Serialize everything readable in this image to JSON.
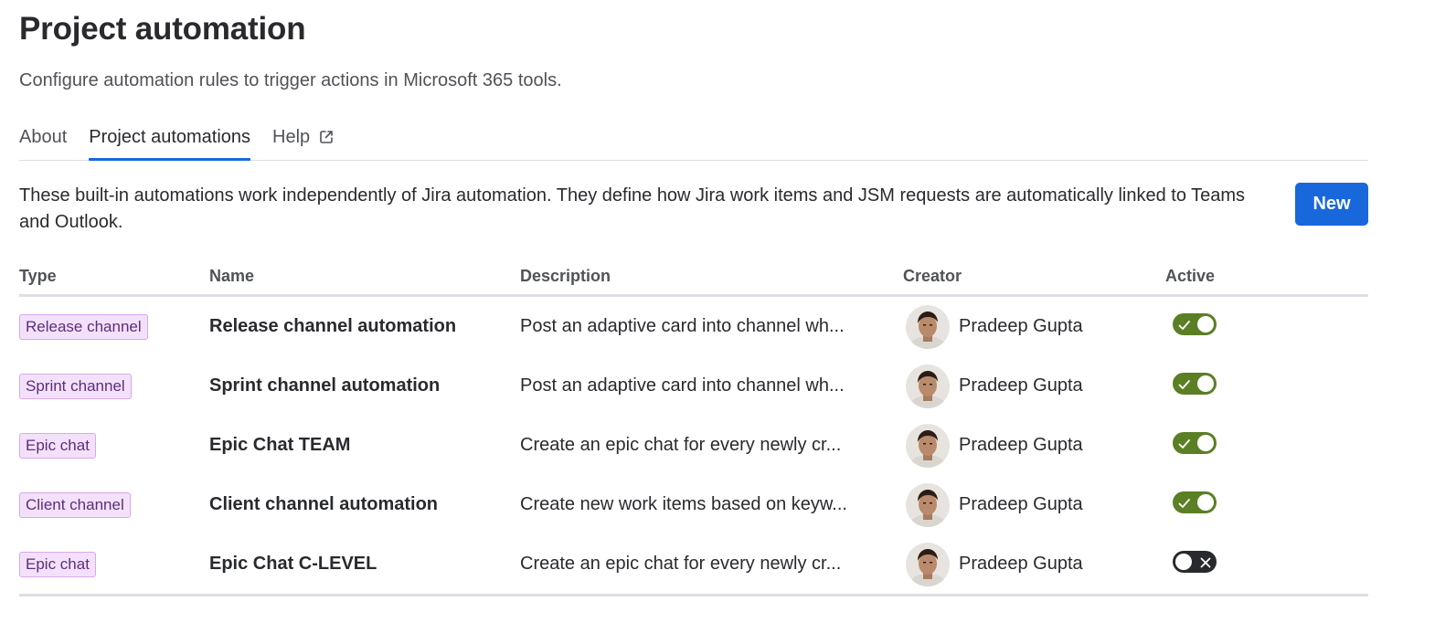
{
  "header": {
    "title": "Project automation",
    "subtitle": "Configure automation rules to trigger actions in Microsoft 365 tools."
  },
  "tabs": [
    {
      "label": "About",
      "selected": false
    },
    {
      "label": "Project automations",
      "selected": true
    },
    {
      "label": "Help",
      "selected": false,
      "icon": "external-link-icon"
    }
  ],
  "intro": {
    "text": "These built-in automations work independently of Jira automation. They define how Jira work items and JSM requests are automatically linked to Teams and Outlook.",
    "new_button_label": "New"
  },
  "table": {
    "columns": {
      "type": "Type",
      "name": "Name",
      "description": "Description",
      "creator": "Creator",
      "active": "Active"
    },
    "rows": [
      {
        "type": "Release channel",
        "name": "Release channel automation",
        "description": "Post an adaptive card into channel wh...",
        "creator": "Pradeep Gupta",
        "active": true
      },
      {
        "type": "Sprint channel",
        "name": "Sprint channel automation",
        "description": "Post an adaptive card into channel wh...",
        "creator": "Pradeep Gupta",
        "active": true
      },
      {
        "type": "Epic chat",
        "name": "Epic Chat TEAM",
        "description": "Create an epic chat for every newly cr...",
        "creator": "Pradeep Gupta",
        "active": true
      },
      {
        "type": "Client channel",
        "name": "Client channel automation",
        "description": "Create new work items based on keyw...",
        "creator": "Pradeep Gupta",
        "active": true
      },
      {
        "type": "Epic chat",
        "name": "Epic Chat C-LEVEL",
        "description": "Create an epic chat for every newly cr...",
        "creator": "Pradeep Gupta",
        "active": false
      }
    ]
  },
  "colors": {
    "accent": "#1868db",
    "toggle_on": "#5b7f24",
    "toggle_off": "#292a2e",
    "lozenge_bg": "#f3e1fb",
    "lozenge_border": "#d9a7f0",
    "lozenge_text": "#5e2d79"
  }
}
